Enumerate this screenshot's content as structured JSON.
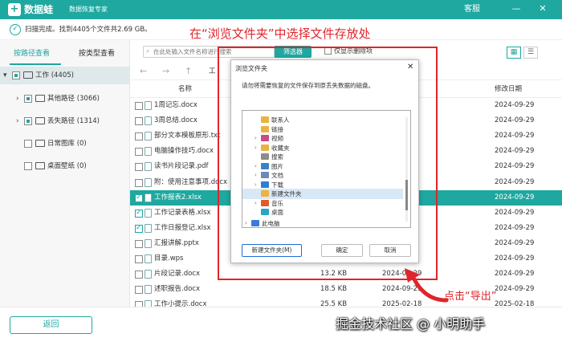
{
  "titlebar": {
    "app_name": "数据蛙",
    "subtitle": "数据恢复专家",
    "support": "客服",
    "logo": "+",
    "minimize": "—",
    "close": "✕"
  },
  "scan": {
    "text": "扫描完成。找到4405个文件共2.69 GB。"
  },
  "sidebar": {
    "tabs": [
      {
        "label": "按路径查看"
      },
      {
        "label": "按类型查看"
      }
    ],
    "items": [
      {
        "label": "工作 (4405)"
      },
      {
        "label": "其他路径 (3066)"
      },
      {
        "label": "丢失路径 (1314)"
      },
      {
        "label": "日常图库 (0)"
      },
      {
        "label": "桌面壁纸 (0)"
      }
    ]
  },
  "toolbar": {
    "search_placeholder": "在此处输入文件名称进行搜索",
    "filter": "筛选器",
    "show_deleted": "仅显示删除项"
  },
  "path": {
    "current": "工"
  },
  "table": {
    "headers": {
      "name": "名称",
      "date": "修改日期"
    },
    "rows": [
      {
        "name": "1周记忘.docx",
        "size": "",
        "modified": "",
        "date": "2024-09-29",
        "checked": false,
        "selected": false
      },
      {
        "name": "3周总结.docx",
        "size": "",
        "modified": "",
        "date": "2024-09-29",
        "checked": false,
        "selected": false
      },
      {
        "name": "部分文本模板原形.txt",
        "size": "",
        "modified": "",
        "date": "2024-09-29",
        "checked": false,
        "selected": false
      },
      {
        "name": "电脑操作技巧.docx",
        "size": "",
        "modified": "",
        "date": "2024-09-29",
        "checked": false,
        "selected": false
      },
      {
        "name": "读书片段记录.pdf",
        "size": "",
        "modified": "",
        "date": "2024-09-29",
        "checked": false,
        "selected": false
      },
      {
        "name": "附：使用注意事项.docx",
        "size": "",
        "modified": "",
        "date": "2024-09-29",
        "checked": false,
        "selected": false
      },
      {
        "name": "工作报表2.xlsx",
        "size": "",
        "modified": "",
        "date": "2024-09-29",
        "checked": true,
        "selected": true
      },
      {
        "name": "工作记录表格.xlsx",
        "size": "",
        "modified": "",
        "date": "2024-09-29",
        "checked": true,
        "selected": false
      },
      {
        "name": "工作日报登记.xlsx",
        "size": "",
        "modified": "",
        "date": "2024-09-29",
        "checked": true,
        "selected": false
      },
      {
        "name": "汇报讲解.pptx",
        "size": "",
        "modified": "",
        "date": "2024-09-29",
        "checked": false,
        "selected": false
      },
      {
        "name": "目录.wps",
        "size": "",
        "modified": "",
        "date": "2024-09-29",
        "checked": false,
        "selected": false
      },
      {
        "name": "片段记录.docx",
        "size": "13.2 KB",
        "modified": "2024-09-29",
        "date": "2024-09-29",
        "checked": false,
        "selected": false
      },
      {
        "name": "述职报告.docx",
        "size": "18.5 KB",
        "modified": "2024-09-29",
        "date": "2024-09-29",
        "checked": false,
        "selected": false
      },
      {
        "name": "工作小提示.docx",
        "size": "25.5 KB",
        "modified": "2025-02-18",
        "date": "2025-02-18",
        "checked": false,
        "selected": false
      }
    ]
  },
  "footer": {
    "back": "返回"
  },
  "annotations": {
    "top": "在“浏览文件夹”中选择文件存放处",
    "export": "点击“导出”",
    "watermark": "掘金技术社区 @ 小明助手"
  },
  "dialog": {
    "title": "浏览文件夹",
    "close": "✕",
    "message": "请勿将需要恢复的文件保存到原丢失数据的磁盘。",
    "tree": [
      {
        "label": "联系人"
      },
      {
        "label": "链接"
      },
      {
        "label": "视频"
      },
      {
        "label": "收藏夹"
      },
      {
        "label": "搜索"
      },
      {
        "label": "图片"
      },
      {
        "label": "文档"
      },
      {
        "label": "下载"
      },
      {
        "label": "新建文件夹"
      },
      {
        "label": "音乐"
      },
      {
        "label": "桌面"
      },
      {
        "label": "此电脑"
      }
    ],
    "new_folder": "新建文件夹(M)",
    "ok": "确定",
    "cancel": "取消"
  },
  "colors": {
    "accent": "#1ea8a0",
    "annotation": "#e0252a"
  }
}
